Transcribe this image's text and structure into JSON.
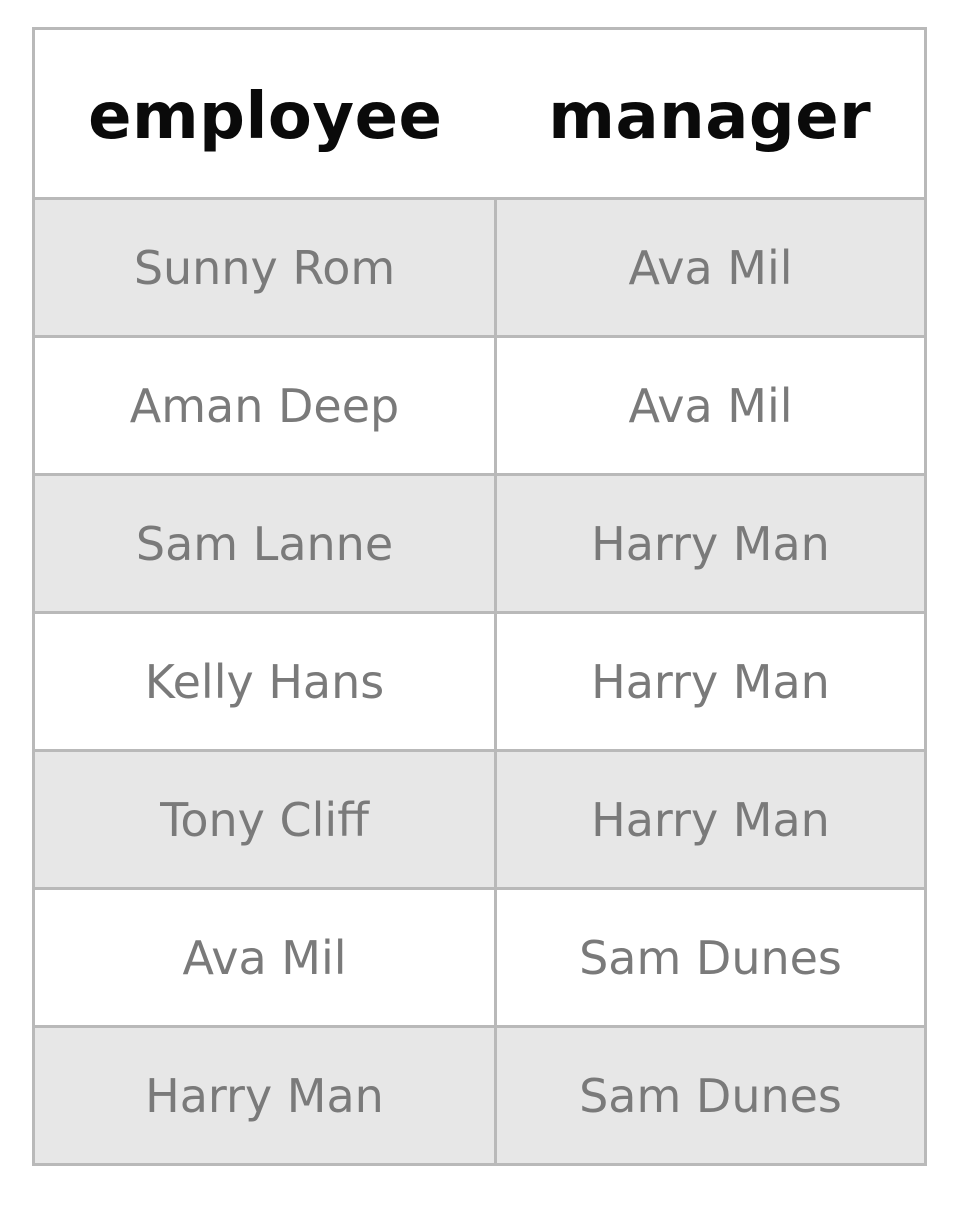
{
  "table": {
    "headers": [
      "employee",
      "manager"
    ],
    "rows": [
      [
        "Sunny Rom",
        "Ava Mil"
      ],
      [
        "Aman Deep",
        "Ava Mil"
      ],
      [
        "Sam Lanne",
        "Harry Man"
      ],
      [
        "Kelly Hans",
        "Harry Man"
      ],
      [
        "Tony Cliff",
        "Harry Man"
      ],
      [
        "Ava Mil",
        "Sam Dunes"
      ],
      [
        "Harry Man",
        "Sam Dunes"
      ]
    ]
  },
  "colors": {
    "border": "#b9b9b9",
    "stripe": "#e7e7e7",
    "cell_text": "#7a7a7a",
    "header_text": "#0a0a0a"
  }
}
